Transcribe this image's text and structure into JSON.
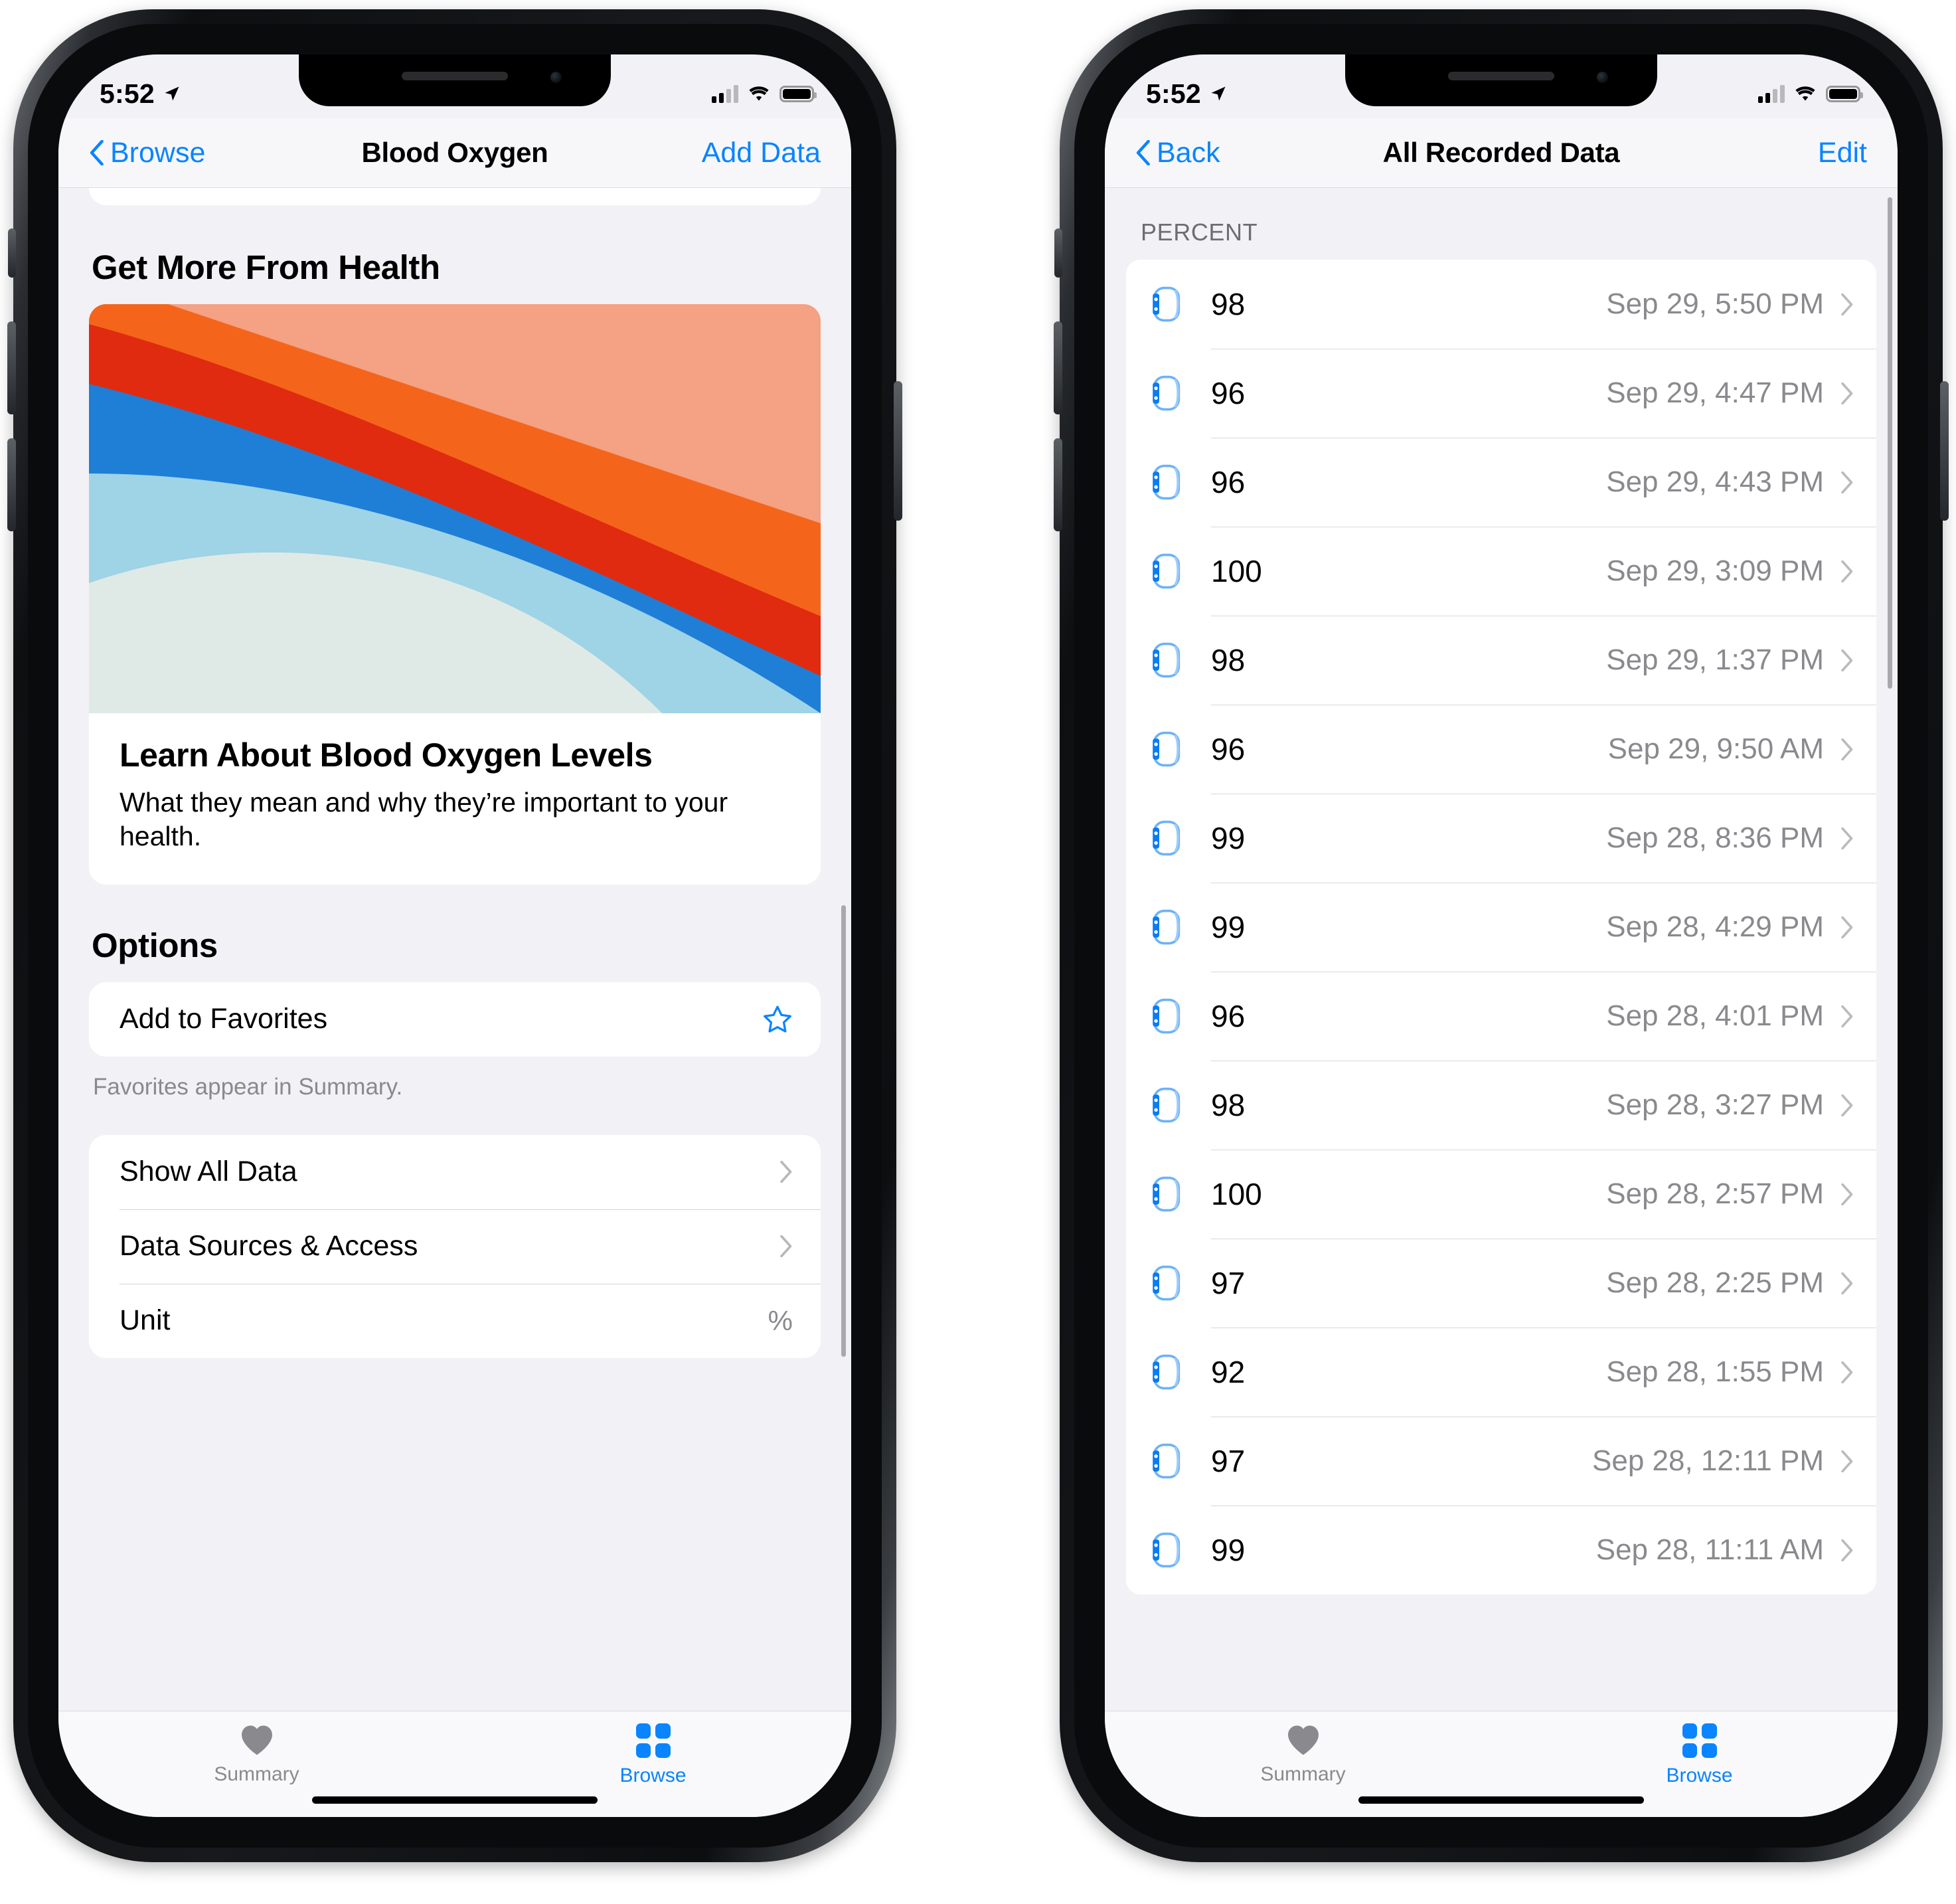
{
  "phones": [
    {
      "id": "blood-oxygen-detail",
      "status": {
        "time": "5:52",
        "location_icon": "location-arrow-icon",
        "cellular": "signal-bars-icon",
        "wifi": "wifi-icon",
        "battery": "battery-icon"
      },
      "nav": {
        "back_label": "Browse",
        "title": "Blood Oxygen",
        "action_label": "Add Data"
      },
      "get_more": {
        "header": "Get More From Health",
        "card_title": "Learn About Blood Oxygen Levels",
        "card_subtitle": "What they mean and why they’re important to your health."
      },
      "options": {
        "header": "Options",
        "favorite_row": {
          "label": "Add to Favorites",
          "icon": "star-outline-icon"
        },
        "footnote": "Favorites appear in Summary.",
        "rows": [
          {
            "label": "Show All Data",
            "value": "",
            "accessory": "chevron-right-icon"
          },
          {
            "label": "Data Sources & Access",
            "value": "",
            "accessory": "chevron-right-icon"
          },
          {
            "label": "Unit",
            "value": "%",
            "accessory": ""
          }
        ]
      },
      "tabs": [
        {
          "label": "Summary",
          "icon": "heart-icon",
          "active": false
        },
        {
          "label": "Browse",
          "icon": "grid-icon",
          "active": true
        }
      ]
    },
    {
      "id": "all-recorded-data",
      "status": {
        "time": "5:52",
        "location_icon": "location-arrow-icon",
        "cellular": "signal-bars-icon",
        "wifi": "wifi-icon",
        "battery": "battery-icon"
      },
      "nav": {
        "back_label": "Back",
        "title": "All Recorded Data",
        "action_label": "Edit"
      },
      "list": {
        "section_header": "PERCENT",
        "rows": [
          {
            "source_icon": "apple-watch-icon",
            "value": "98",
            "timestamp": "Sep 29, 5:50 PM"
          },
          {
            "source_icon": "apple-watch-icon",
            "value": "96",
            "timestamp": "Sep 29, 4:47 PM"
          },
          {
            "source_icon": "apple-watch-icon",
            "value": "96",
            "timestamp": "Sep 29, 4:43 PM"
          },
          {
            "source_icon": "apple-watch-icon",
            "value": "100",
            "timestamp": "Sep 29, 3:09 PM"
          },
          {
            "source_icon": "apple-watch-icon",
            "value": "98",
            "timestamp": "Sep 29, 1:37 PM"
          },
          {
            "source_icon": "apple-watch-icon",
            "value": "96",
            "timestamp": "Sep 29, 9:50 AM"
          },
          {
            "source_icon": "apple-watch-icon",
            "value": "99",
            "timestamp": "Sep 28, 8:36 PM"
          },
          {
            "source_icon": "apple-watch-icon",
            "value": "99",
            "timestamp": "Sep 28, 4:29 PM"
          },
          {
            "source_icon": "apple-watch-icon",
            "value": "96",
            "timestamp": "Sep 28, 4:01 PM"
          },
          {
            "source_icon": "apple-watch-icon",
            "value": "98",
            "timestamp": "Sep 28, 3:27 PM"
          },
          {
            "source_icon": "apple-watch-icon",
            "value": "100",
            "timestamp": "Sep 28, 2:57 PM"
          },
          {
            "source_icon": "apple-watch-icon",
            "value": "97",
            "timestamp": "Sep 28, 2:25 PM"
          },
          {
            "source_icon": "apple-watch-icon",
            "value": "92",
            "timestamp": "Sep 28, 1:55 PM"
          },
          {
            "source_icon": "apple-watch-icon",
            "value": "97",
            "timestamp": "Sep 28, 12:11 PM"
          },
          {
            "source_icon": "apple-watch-icon",
            "value": "99",
            "timestamp": "Sep 28, 11:11 AM"
          }
        ]
      },
      "tabs": [
        {
          "label": "Summary",
          "icon": "heart-icon",
          "active": false
        },
        {
          "label": "Browse",
          "icon": "grid-icon",
          "active": true
        }
      ]
    }
  ],
  "colors": {
    "accent": "#0a84ff",
    "secondary_text": "#8a8a8e",
    "group_bg": "#ffffff",
    "page_bg": "#f2f1f6",
    "artwork": [
      "#f4a184",
      "#f4651b",
      "#e02b10",
      "#1f7fd6",
      "#9fd3e6",
      "#dfeae6"
    ]
  }
}
